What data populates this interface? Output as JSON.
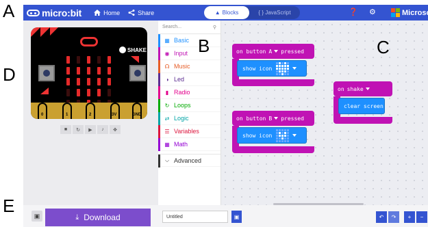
{
  "annotations": [
    "A",
    "B",
    "C",
    "D",
    "E"
  ],
  "header": {
    "brand": "micro:bit",
    "home_label": "Home",
    "share_label": "Share",
    "mode_blocks": "Blocks",
    "mode_js": "{ } JavaScript",
    "microsoft": "Microsoft",
    "brand_color": "#3454d1",
    "icons": [
      "help-icon",
      "gear-icon"
    ]
  },
  "toolbox": {
    "search_placeholder": "Search...",
    "categories": [
      {
        "label": "Basic",
        "color": "#1e90ff",
        "icon": "grid-icon"
      },
      {
        "label": "Input",
        "color": "#c012b4",
        "icon": "input-icon"
      },
      {
        "label": "Music",
        "color": "#e65c26",
        "icon": "headphones-icon"
      },
      {
        "label": "Led",
        "color": "#5c2d91",
        "icon": "toggle-icon"
      },
      {
        "label": "Radio",
        "color": "#e3008c",
        "icon": "signal-icon"
      },
      {
        "label": "Loops",
        "color": "#00aa00",
        "icon": "loop-icon"
      },
      {
        "label": "Logic",
        "color": "#00a4a6",
        "icon": "shuffle-icon"
      },
      {
        "label": "Variables",
        "color": "#dc143c",
        "icon": "list-icon"
      },
      {
        "label": "Math",
        "color": "#9400d3",
        "icon": "calculator-icon"
      }
    ],
    "advanced_label": "Advanced"
  },
  "simulator": {
    "shake_label": "SHAKE",
    "pins": [
      "0",
      "1",
      "2",
      "3V",
      "GND"
    ],
    "controls": [
      "stop-icon",
      "restart-icon",
      "slowmo-icon",
      "mute-icon",
      "fullscreen-icon"
    ]
  },
  "blocks": {
    "event_a": {
      "prefix": "on button",
      "button": "A",
      "suffix": "pressed"
    },
    "show_a": "show icon",
    "event_b": {
      "prefix": "on button",
      "button": "B",
      "suffix": "pressed"
    },
    "show_b": "show icon",
    "event_shake": {
      "prefix": "on",
      "gesture": "shake"
    },
    "clear": "clear screen",
    "colors": {
      "input": "#c012b4",
      "basic": "#1e90ff"
    }
  },
  "bottom": {
    "download_label": "Download",
    "project_name": "Untitled"
  }
}
